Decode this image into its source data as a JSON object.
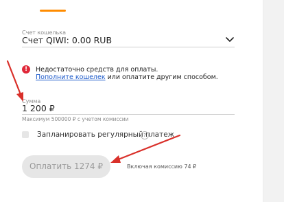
{
  "form": {
    "wallet_label": "Счет кошелька",
    "wallet_value": "Счет QIWI: 0.00 RUB",
    "alert": {
      "icon": "!",
      "line1": "Недостаточно средств для оплаты.",
      "topup_link": "Пополните кошелек",
      "line2_rest": " или оплатите другим способом."
    },
    "sum_label": "Сумма",
    "sum_value": "1 200 ₽",
    "sum_hint": "Максимум 500000 ₽ с учетом комиссии",
    "schedule_label": "Запланировать регулярный платеж",
    "help_icon": "?",
    "pay_button": "Оплатить 1274 ₽",
    "commission": "Включая комиссию 74 ₽"
  },
  "colors": {
    "accent": "#ff8c00",
    "alert": "#e0293a",
    "link": "#1a58c9",
    "annotation_arrow": "#d9302a"
  }
}
